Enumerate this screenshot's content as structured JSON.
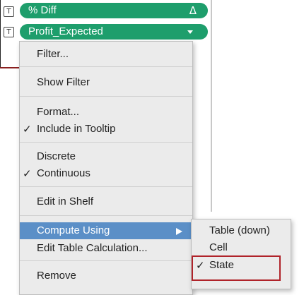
{
  "shelf": {
    "pills": [
      {
        "label": "% Diff",
        "trailing_symbol": "Δ",
        "trailing_icon": "delta-icon"
      },
      {
        "label": "Profit_Expected",
        "trailing_icon": "caret-down-icon"
      }
    ],
    "type_icon_glyph": "T"
  },
  "context_menu": {
    "items": [
      {
        "label": "Filter...",
        "checked": false
      },
      {
        "label": "Show Filter",
        "checked": false
      },
      {
        "label": "Format...",
        "checked": false
      },
      {
        "label": "Include in Tooltip",
        "checked": true
      },
      {
        "label": "Discrete",
        "checked": false
      },
      {
        "label": "Continuous",
        "checked": true
      },
      {
        "label": "Edit in Shelf",
        "checked": false
      },
      {
        "label": "Compute Using",
        "highlighted": true,
        "has_submenu": true
      },
      {
        "label": "Edit Table Calculation...",
        "checked": false
      },
      {
        "label": "Remove",
        "checked": false
      }
    ],
    "check_glyph": "✓"
  },
  "submenu": {
    "items": [
      {
        "label": "Table (down)",
        "checked": false
      },
      {
        "label": "Cell",
        "checked": false
      },
      {
        "label": "State",
        "checked": true
      }
    ]
  },
  "colors": {
    "pill_green": "#1e9e6c",
    "menu_highlight": "#5b8fc7",
    "annotation_red": "#b0232a"
  }
}
